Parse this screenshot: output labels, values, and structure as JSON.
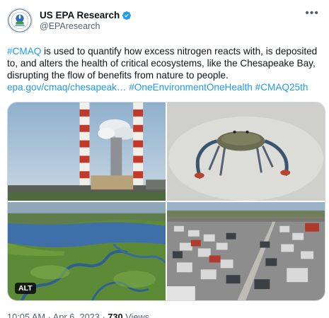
{
  "tweet": {
    "author": {
      "display_name": "US EPA Research",
      "handle": "@EPAresearch",
      "verified": true,
      "avatar_icon": "epa-seal-icon"
    },
    "more_icon": "more-options-icon",
    "text": {
      "hashtag_cmaq": "#CMAQ",
      "body": " is used to quantify how excess nitrogen reacts with, is deposited to, and alters the health of critical ecosystems, like the Chesapeake Bay, disrupting the flow of benefits from nature to people.",
      "link": "epa.gov/cmaq/chesapeak…",
      "hashtag_one": "#OneEnvironmentOneHealth",
      "hashtag_25": "#CMAQ25th"
    },
    "media": {
      "images": [
        "smokestacks-photo",
        "blue-crab-photo",
        "marsh-aerial-photo",
        "highway-traffic-photo"
      ],
      "alt_badge": "ALT"
    },
    "meta": {
      "time": "10:05 AM",
      "separator": " · ",
      "date": "Apr 6, 2023",
      "views_count": "730",
      "views_label": " Views"
    },
    "colors": {
      "link": "#1d9bf0",
      "verified": "#1d9bf0",
      "secondary_text": "#536471"
    }
  }
}
